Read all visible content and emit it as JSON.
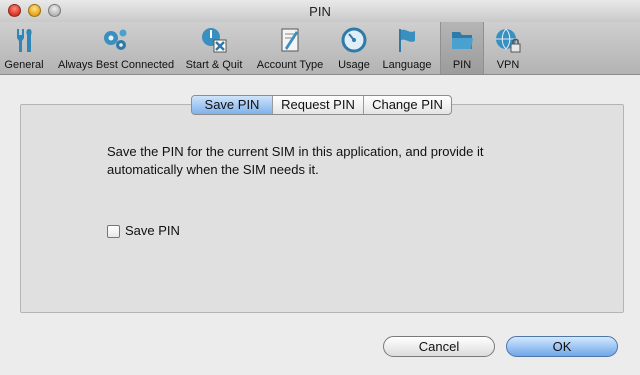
{
  "window": {
    "title": "PIN"
  },
  "toolbar": {
    "items": [
      {
        "label": "General",
        "icon": "tools-icon"
      },
      {
        "label": "Always Best Connected",
        "icon": "gears-icon"
      },
      {
        "label": "Start & Quit",
        "icon": "start-quit-icon"
      },
      {
        "label": "Account Type",
        "icon": "account-document-icon"
      },
      {
        "label": "Usage",
        "icon": "gauge-icon"
      },
      {
        "label": "Language",
        "icon": "flag-icon"
      },
      {
        "label": "PIN",
        "icon": "folder-icon",
        "selected": true
      },
      {
        "label": "VPN",
        "icon": "globe-lock-icon"
      }
    ]
  },
  "tabs": {
    "items": [
      {
        "label": "Save PIN",
        "active": true
      },
      {
        "label": "Request PIN",
        "active": false
      },
      {
        "label": "Change PIN",
        "active": false
      }
    ]
  },
  "content": {
    "description": "Save the PIN for the current SIM in this application, and provide it automatically when the SIM needs it.",
    "checkbox_label": "Save PIN",
    "checkbox_checked": false
  },
  "buttons": {
    "cancel": "Cancel",
    "ok": "OK"
  },
  "colors": {
    "accent": "#6fa6e8",
    "window_background": "#ececec"
  }
}
